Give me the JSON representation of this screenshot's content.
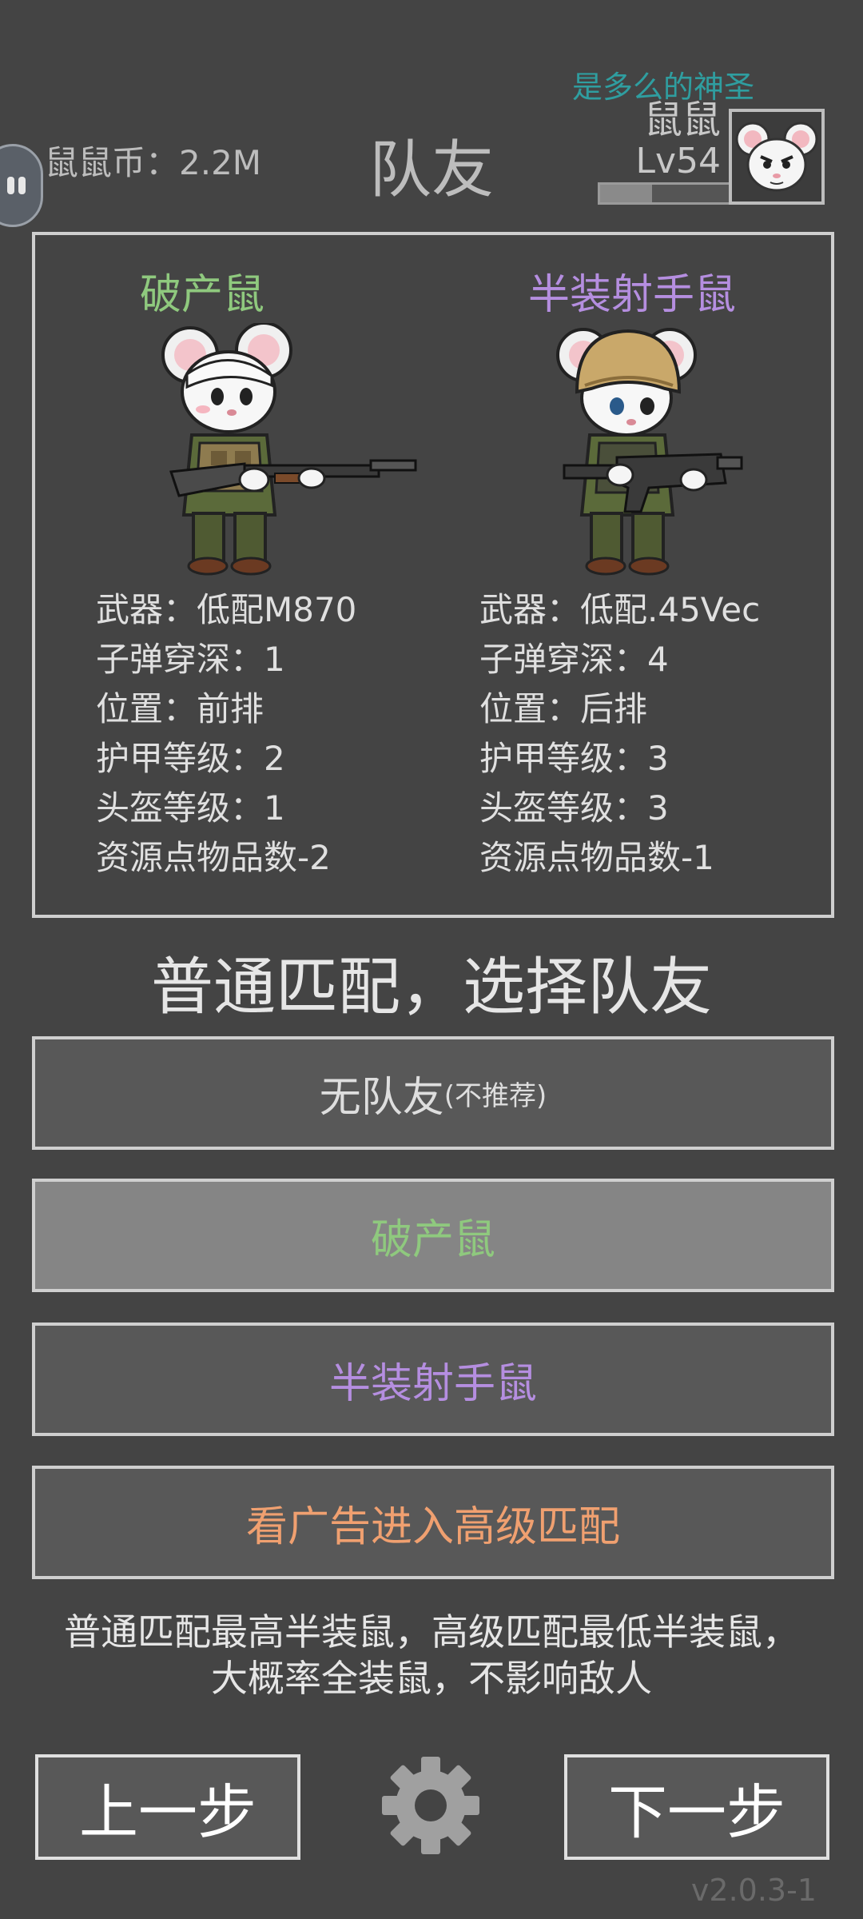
{
  "header": {
    "coins_label": "鼠鼠币：2.2M",
    "title": "队友",
    "player_name": "是多么的神圣",
    "player_label": "鼠鼠",
    "player_level": "Lv54",
    "xp_progress": 0.4
  },
  "teammates": [
    {
      "name": "破产鼠",
      "name_color": "#8fc97e",
      "stats": [
        "武器：低配M870",
        "子弹穿深：1",
        "位置：前排",
        "护甲等级：2",
        "头盔等级：1",
        "资源点物品数-2"
      ]
    },
    {
      "name": "半装射手鼠",
      "name_color": "#b58ee0",
      "stats": [
        "武器：低配.45Vec",
        "子弹穿深：4",
        "位置：后排",
        "护甲等级：3",
        "头盔等级：3",
        "资源点物品数-1"
      ]
    }
  ],
  "section_title": "普通匹配，选择队友",
  "options": {
    "no_teammate": {
      "label": "无队友",
      "note": "(不推荐)",
      "color": "#dedede"
    },
    "broke_mouse": {
      "label": "破产鼠",
      "color": "#8fc97e",
      "selected": true
    },
    "half_gear_shooter": {
      "label": "半装射手鼠",
      "color": "#b58ee0"
    },
    "ad_advanced": {
      "label": "看广告进入高级匹配",
      "color": "#f0a070"
    }
  },
  "info_text": "普通匹配最高半装鼠，高级匹配最低半装鼠，大概率全装鼠，不影响敌人",
  "nav": {
    "prev_label": "上一步",
    "next_label": "下一步",
    "settings_icon": "gear-icon"
  },
  "version": "v2.0.3-1"
}
